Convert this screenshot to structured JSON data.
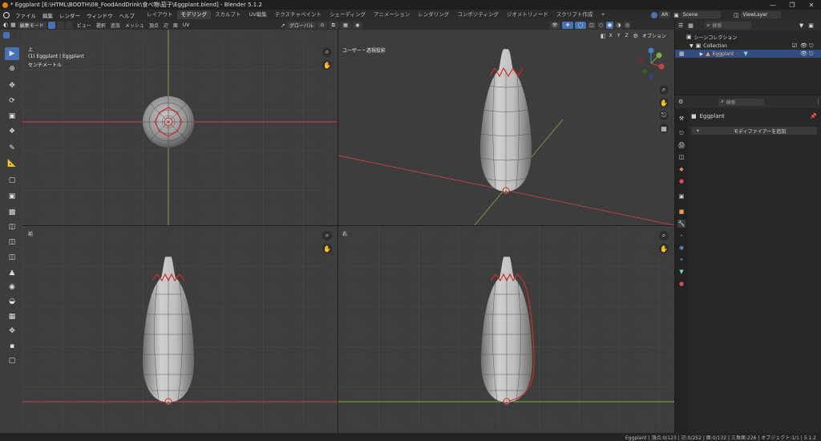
{
  "window": {
    "title": "* Eggplant [E:\\HTML\\BOOTH\\08_FoodAndDrink\\食べ物\\茄子\\Eggplant.blend] - Blender 5.1.2"
  },
  "menu": [
    "ファイル",
    "編集",
    "レンダー",
    "ウィンドウ",
    "ヘルプ"
  ],
  "workspaces": {
    "tabs": [
      "レイアウト",
      "モデリング",
      "スカルプト",
      "UV編集",
      "テクスチャペイント",
      "シェーディング",
      "アニメーション",
      "レンダリング",
      "コンポジティング",
      "ジオメトリノード",
      "スクリプト作成"
    ],
    "active": "モデリング",
    "add": "+"
  },
  "top_right": {
    "ar_label": "AR",
    "scene_label": "Scene",
    "view_layer_label": "ViewLayer"
  },
  "viewport_header": {
    "mode": "編集モード",
    "menus": [
      "ビュー",
      "選択",
      "追加",
      "メッシュ",
      "頂点",
      "辺",
      "面",
      "UV"
    ],
    "transform_orientation": "グローバル",
    "axes": [
      "X",
      "Y",
      "Z"
    ],
    "options_label": "オプション"
  },
  "viewports": {
    "top": {
      "view_name": "上",
      "object_info": "(1) Eggplant | Eggplant",
      "unit": "センチメートル"
    },
    "persp": {
      "view_name": "ユーザー・透視投影"
    },
    "front": {
      "view_name": "前"
    },
    "right": {
      "view_name": "右"
    }
  },
  "outliner": {
    "search_placeholder": "検索",
    "scene_collection": "シーンコレクション",
    "collection": "Collection",
    "object": "Eggplant"
  },
  "properties": {
    "search_placeholder": "検索",
    "object_name": "Eggplant",
    "add_modifier": "モディファイアーを追加"
  },
  "status_bar": {
    "text": "Eggplant | 頂点:0/123 | 辺:0/252 | 面:0/132 | 三角面:226 | オブジェクト:1/1 | 5.1.2"
  },
  "colors": {
    "accent": "#4772b3",
    "viewport_bg": "#3d3d3d",
    "x_axis": "#c44545",
    "y_axis": "#7fae3a",
    "mesh_edge": "#c8302d"
  }
}
